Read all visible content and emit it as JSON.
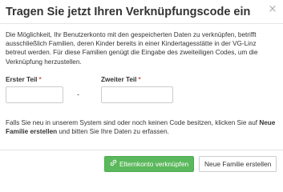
{
  "dialog": {
    "title": "Tragen Sie jetzt Ihren Verknüpfungscode ein",
    "close_symbol": "×"
  },
  "body": {
    "intro": "Die Möglichkeit, Ihr Benutzerkonto mit den gespeicherten Daten zu verknüpfen, betrifft ausschließlich Familien, deren Kinder bereits in einer Kindertagesstätte in der VG-Linz betreut werden. Für diese Familien genügt die Eingabe des zweiteiligen Codes, um die Verknüpfung herzustellen.",
    "field_1": {
      "label": "Erster Teil",
      "required_mark": "*",
      "value": "",
      "placeholder": ""
    },
    "separator": "-",
    "field_2": {
      "label": "Zweiter Teil",
      "required_mark": "*",
      "value": "",
      "placeholder": ""
    },
    "help_before": "Falls Sie neu in unserem System sind oder noch keinen Code besitzen, klicken Sie auf ",
    "help_strong": "Neue Familie erstellen",
    "help_after": " und bitten Sie Ihre Daten zu erfassen."
  },
  "footer": {
    "primary_button": {
      "icon": "link-icon",
      "label": "Elternkonto verknüpfen"
    },
    "secondary_button": {
      "label": "Neue Familie erstellen"
    }
  },
  "colors": {
    "primary": "#5cb85c",
    "required": "#d9534f",
    "border": "#cccccc",
    "text": "#333333"
  }
}
